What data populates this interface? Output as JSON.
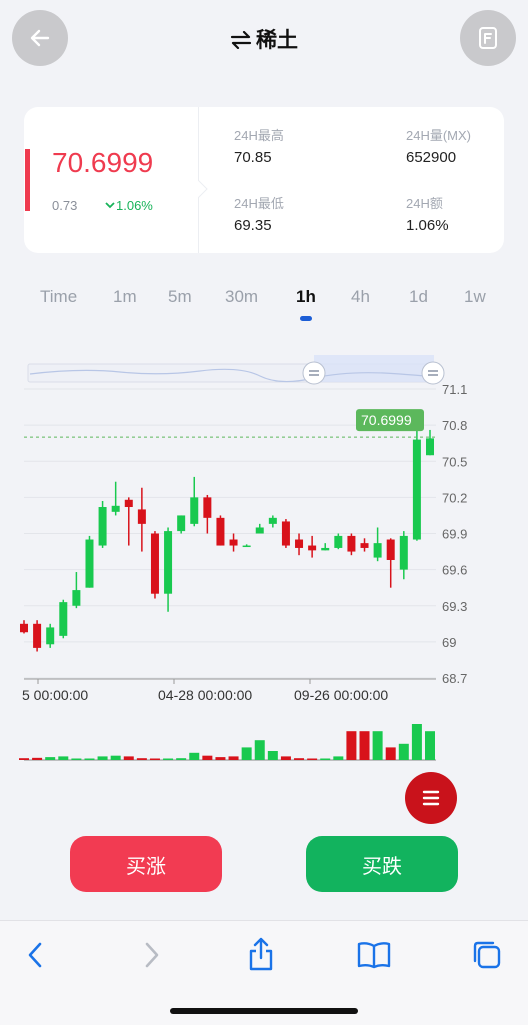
{
  "header": {
    "title": "稀土",
    "swap_icon": "swap-arrows-icon",
    "back_icon": "arrow-left-icon",
    "doc_icon": "document-icon"
  },
  "summary": {
    "price": "70.6999",
    "change": "0.73",
    "change_pct": "1.06%",
    "stats": [
      {
        "label": "24H最高",
        "value": "70.85"
      },
      {
        "label": "24H量(MX)",
        "value": "652900"
      },
      {
        "label": "24H最低",
        "value": "69.35"
      },
      {
        "label": "24H额",
        "value": "1.06%"
      }
    ]
  },
  "timeframes": {
    "items": [
      "Time",
      "1m",
      "5m",
      "30m",
      "1h",
      "4h",
      "1d",
      "1w"
    ],
    "active": "1h"
  },
  "chart_data": {
    "type": "candlestick",
    "y_ticks": [
      "71.1",
      "70.8",
      "70.5",
      "70.2",
      "69.9",
      "69.6",
      "69.3",
      "69",
      "68.7"
    ],
    "ylim": [
      68.7,
      71.1
    ],
    "x_ticks": [
      "5 00:00:00",
      "04-28 00:00:00",
      "09-26 00:00:00"
    ],
    "last_price_label": "70.6999",
    "last_price": 70.6999,
    "candles": [
      {
        "o": 69.15,
        "h": 69.18,
        "l": 69.07,
        "c": 69.08
      },
      {
        "o": 69.15,
        "h": 69.18,
        "l": 68.92,
        "c": 68.95
      },
      {
        "o": 68.98,
        "h": 69.15,
        "l": 68.95,
        "c": 69.12
      },
      {
        "o": 69.05,
        "h": 69.35,
        "l": 69.03,
        "c": 69.33
      },
      {
        "o": 69.3,
        "h": 69.58,
        "l": 69.28,
        "c": 69.43
      },
      {
        "o": 69.45,
        "h": 69.88,
        "l": 69.45,
        "c": 69.85
      },
      {
        "o": 69.8,
        "h": 70.17,
        "l": 69.78,
        "c": 70.12
      },
      {
        "o": 70.08,
        "h": 70.33,
        "l": 70.05,
        "c": 70.13
      },
      {
        "o": 70.18,
        "h": 70.2,
        "l": 69.8,
        "c": 70.12
      },
      {
        "o": 70.1,
        "h": 70.28,
        "l": 69.75,
        "c": 69.98
      },
      {
        "o": 69.9,
        "h": 69.92,
        "l": 69.36,
        "c": 69.4
      },
      {
        "o": 69.4,
        "h": 69.95,
        "l": 69.25,
        "c": 69.92
      },
      {
        "o": 69.92,
        "h": 70.05,
        "l": 69.9,
        "c": 70.05
      },
      {
        "o": 69.98,
        "h": 70.37,
        "l": 69.96,
        "c": 70.2
      },
      {
        "o": 70.2,
        "h": 70.22,
        "l": 69.9,
        "c": 70.03
      },
      {
        "o": 70.03,
        "h": 70.05,
        "l": 69.8,
        "c": 69.8
      },
      {
        "o": 69.85,
        "h": 69.9,
        "l": 69.75,
        "c": 69.8
      },
      {
        "o": 69.8,
        "h": 69.81,
        "l": 69.79,
        "c": 69.8
      },
      {
        "o": 69.9,
        "h": 69.98,
        "l": 69.9,
        "c": 69.95
      },
      {
        "o": 69.98,
        "h": 70.05,
        "l": 69.95,
        "c": 70.03
      },
      {
        "o": 70.0,
        "h": 70.02,
        "l": 69.78,
        "c": 69.8
      },
      {
        "o": 69.85,
        "h": 69.9,
        "l": 69.72,
        "c": 69.78
      },
      {
        "o": 69.8,
        "h": 69.88,
        "l": 69.7,
        "c": 69.76
      },
      {
        "o": 69.76,
        "h": 69.82,
        "l": 69.76,
        "c": 69.78
      },
      {
        "o": 69.78,
        "h": 69.9,
        "l": 69.77,
        "c": 69.88
      },
      {
        "o": 69.88,
        "h": 69.9,
        "l": 69.72,
        "c": 69.75
      },
      {
        "o": 69.82,
        "h": 69.86,
        "l": 69.75,
        "c": 69.78
      },
      {
        "o": 69.7,
        "h": 69.95,
        "l": 69.67,
        "c": 69.82
      },
      {
        "o": 69.85,
        "h": 69.86,
        "l": 69.45,
        "c": 69.68
      },
      {
        "o": 69.6,
        "h": 69.92,
        "l": 69.52,
        "c": 69.88
      },
      {
        "o": 69.85,
        "h": 70.8,
        "l": 69.84,
        "c": 70.68
      },
      {
        "o": 70.55,
        "h": 70.76,
        "l": 70.55,
        "c": 70.69
      }
    ],
    "volumes": [
      0.05,
      0.06,
      0.08,
      0.1,
      0.02,
      0.02,
      0.1,
      0.12,
      0.1,
      0.05,
      0.02,
      0.02,
      0.05,
      0.2,
      0.12,
      0.08,
      0.1,
      0.35,
      0.55,
      0.25,
      0.1,
      0.05,
      0.02,
      0.02,
      0.1,
      0.8,
      0.8,
      0.8,
      0.35,
      0.45,
      1.0,
      0.8
    ],
    "colors": {
      "up": "#19c94f",
      "down": "#d8121b",
      "grid": "#e3e5ea",
      "last": "#5cb85c"
    }
  },
  "actions": {
    "buy_up": "买涨",
    "buy_down": "买跌",
    "up_color": "#f23b52",
    "down_color": "#12b35e"
  },
  "browser_toolbar": {
    "icons": [
      "chevron-left-icon",
      "chevron-right-icon",
      "share-icon",
      "book-icon",
      "tabs-icon"
    ]
  }
}
